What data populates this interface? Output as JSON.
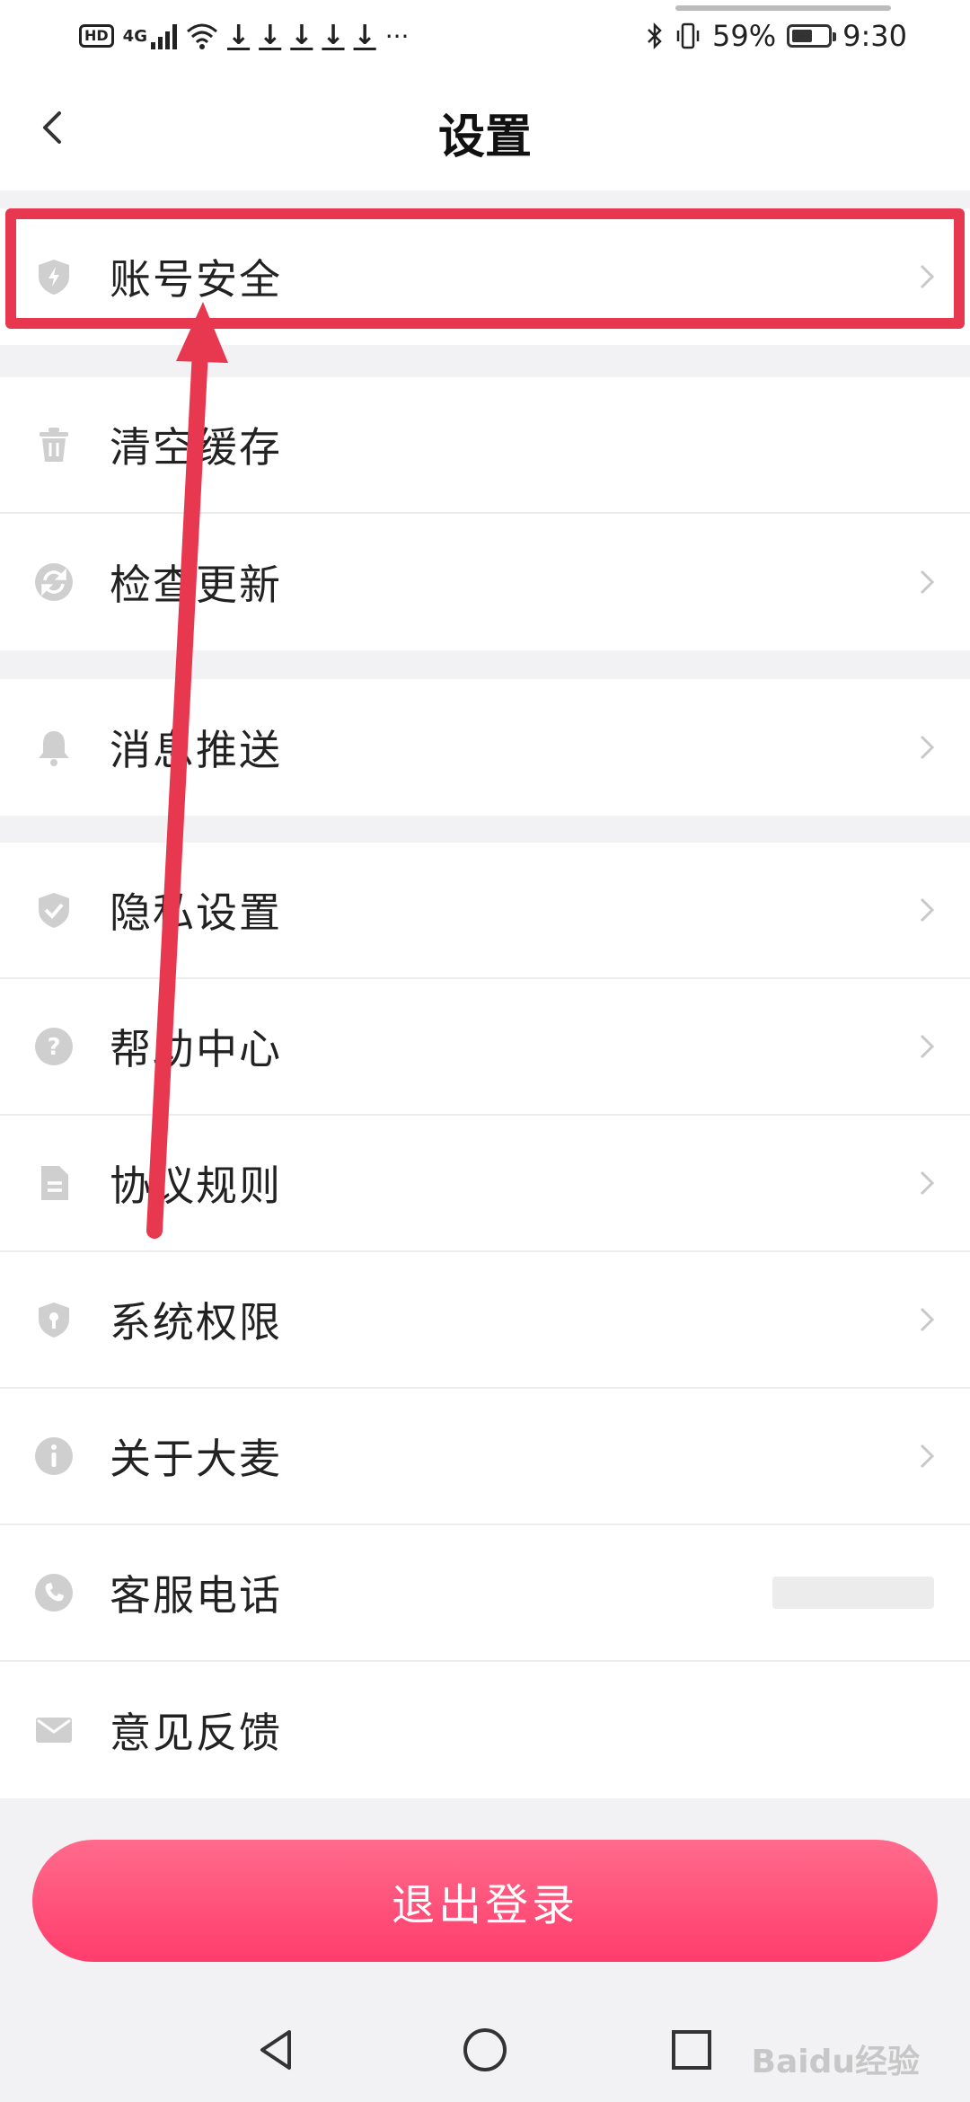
{
  "status_bar": {
    "hd": "HD",
    "network": "4G",
    "more": "···",
    "battery": "59%",
    "time": "9:30"
  },
  "header": {
    "title": "设置"
  },
  "groups": [
    {
      "items": [
        {
          "label": "账号安全",
          "icon": "shield-bolt-icon",
          "chevron": true
        }
      ]
    },
    {
      "items": [
        {
          "label": "清空缓存",
          "icon": "trash-icon",
          "chevron": false
        },
        {
          "label": "检查更新",
          "icon": "refresh-icon",
          "chevron": true
        }
      ]
    },
    {
      "items": [
        {
          "label": "消息推送",
          "icon": "bell-icon",
          "chevron": true
        }
      ]
    },
    {
      "items": [
        {
          "label": "隐私设置",
          "icon": "shield-check-icon",
          "chevron": true
        },
        {
          "label": "帮助中心",
          "icon": "question-icon",
          "chevron": true
        },
        {
          "label": "协议规则",
          "icon": "document-icon",
          "chevron": true
        },
        {
          "label": "系统权限",
          "icon": "shield-keyhole-icon",
          "chevron": true
        },
        {
          "label": "关于大麦",
          "icon": "info-icon",
          "chevron": true
        },
        {
          "label": "客服电话",
          "icon": "phone-icon",
          "chevron": false
        },
        {
          "label": "意见反馈",
          "icon": "mail-icon",
          "chevron": false
        }
      ]
    }
  ],
  "logout": {
    "label": "退出登录"
  },
  "watermark": "Baidu经验",
  "colors": {
    "accent": "#ff4d75",
    "annotation": "#e8384f",
    "icon": "#cfcfcf"
  }
}
